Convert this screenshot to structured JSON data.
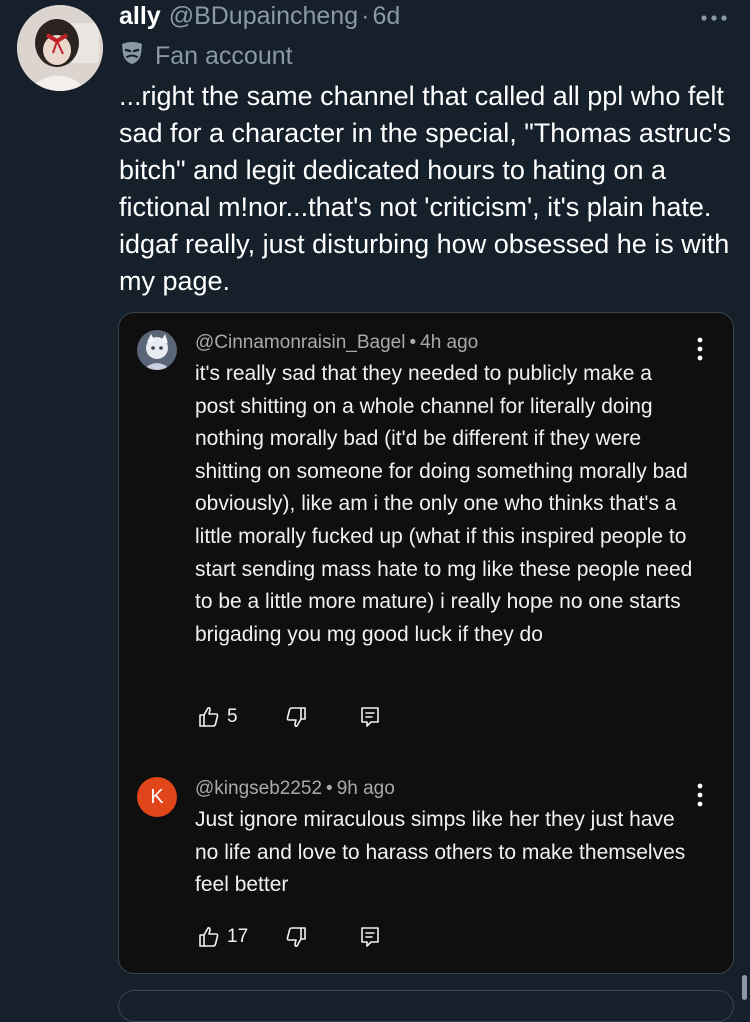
{
  "tweet": {
    "author_name": "ally",
    "handle": "@BDupaincheng",
    "separator": "·",
    "time": "6d",
    "badge_label": "Fan account",
    "badge_icon": "theater-mask-icon",
    "text": "...right the same channel that called all ppl who felt sad for a character in the special, \"Thomas astruc's bitch\" and legit dedicated hours to hating on a fictional m!nor...that's not 'criticism', it's plain hate. idgaf really, just disturbing how obsessed he is with my page.",
    "more_icon": "more-horizontal-icon"
  },
  "screenshot_card": {
    "comments": [
      {
        "username": "@Cinnamonraisin_Bagel",
        "time": "4h ago",
        "text": "it's really sad that they needed to publicly make a post shitting on a whole channel for literally doing nothing morally bad (it'd be different if they were shitting on someone for doing something morally bad obviously), like am i the only one who thinks that's a little morally fucked up (what if this inspired people to start sending mass hate to mg like these people need to be a little more mature) i really hope no one starts brigading you mg good luck if they do",
        "likes": "5"
      },
      {
        "username": "@kingseb2252",
        "time": "9h ago",
        "avatar_letter": "K",
        "avatar_color": "#e0461a",
        "text": "Just ignore miraculous simps like her they just have no life and love to harass others to make themselves feel better",
        "likes": "17"
      }
    ],
    "dot": "•"
  },
  "colors": {
    "background": "#15202b",
    "secondary_text": "#8b98a5",
    "card_background": "#0f0f0f"
  }
}
